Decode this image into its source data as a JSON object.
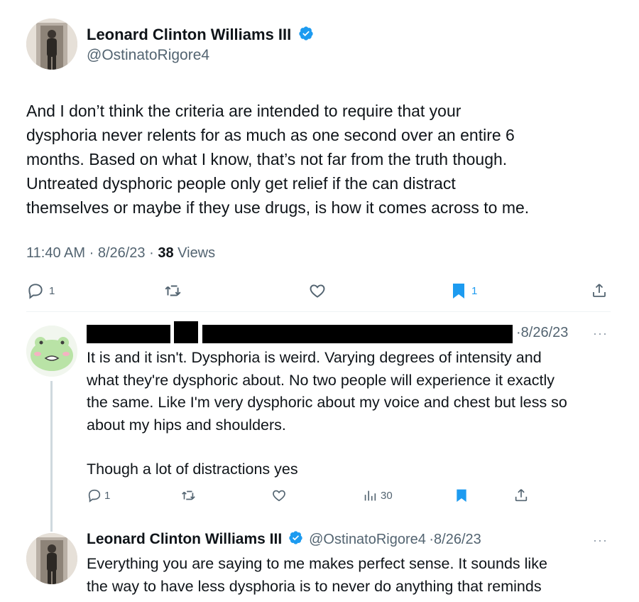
{
  "main_tweet": {
    "author_name": "Leonard Clinton Williams III",
    "author_handle": "@OstinatoRigore4",
    "text_lines": [
      "And I don’t think the criteria are intended to require that your",
      "dysphoria never relents for as much as one second over an entire 6",
      "months. Based on what I know, that’s not far from the truth though.",
      "Untreated dysphoric people only get relief if the can distract",
      "themselves or maybe if they use drugs, is how it comes across to me."
    ],
    "time": "11:40 AM",
    "date": "8/26/23",
    "views_count": "38",
    "views_label": "Views",
    "reply_count": "1",
    "bookmark_count": "1"
  },
  "reply": {
    "date": "8/26/23",
    "paragraph_1_lines": [
      "It is and it isn't. Dysphoria is weird. Varying degrees of intensity and",
      "what they're dysphoric about. No two people will experience it exactly",
      "the same. Like I'm very dysphoric about my voice and chest but less so",
      "about my hips and shoulders."
    ],
    "paragraph_2": "Though a lot of distractions yes",
    "reply_count": "1",
    "views_count": "30",
    "more": "···"
  },
  "reply_2": {
    "author_name": "Leonard Clinton Williams III",
    "author_handle": "@OstinatoRigore4",
    "date": "8/26/23",
    "text_lines": [
      "Everything you are saying to me makes perfect sense. It sounds like",
      "the way to have less dysphoria is to never do anything that reminds"
    ],
    "more": "···"
  },
  "colors": {
    "accent": "#1d9bf0",
    "muted": "#536471",
    "text": "#0f1419"
  },
  "icons": [
    "verified-badge-icon",
    "reply-icon",
    "retweet-icon",
    "like-icon",
    "bookmark-icon",
    "share-icon",
    "views-icon",
    "more-icon"
  ]
}
